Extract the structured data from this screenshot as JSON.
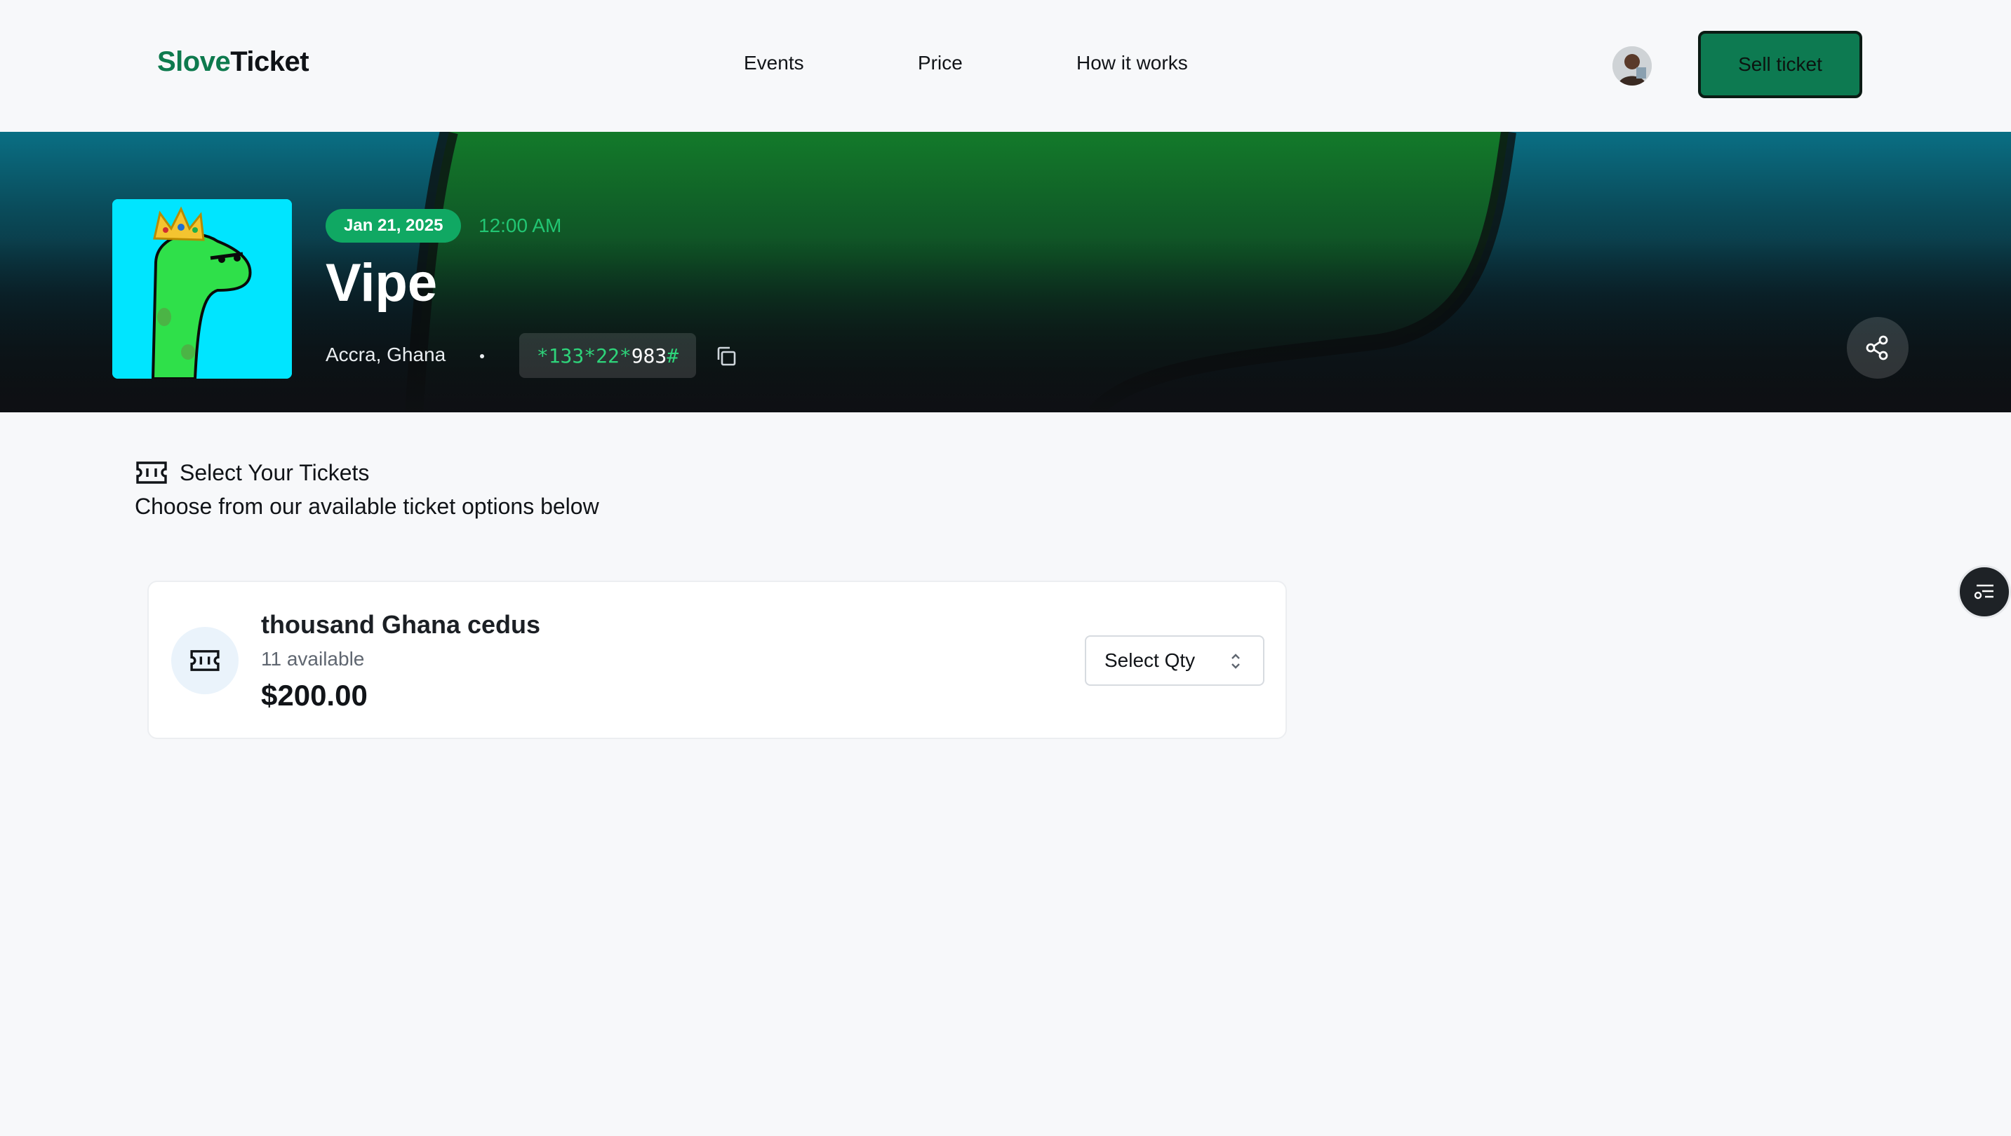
{
  "brand": {
    "part1": "Slove",
    "part2": "Ticket",
    "accent": "#0e7a4e"
  },
  "nav": {
    "items": [
      "Events",
      "Price",
      "How it works"
    ]
  },
  "header": {
    "sell_label": "Sell ticket",
    "sell_color": "#0d7a51"
  },
  "event": {
    "date": "Jan 21, 2025",
    "time": "12:00 AM",
    "title": "Vipe",
    "location": "Accra, Ghana",
    "ussd_prefix": "*133*22*",
    "ussd_number": "983",
    "ussd_suffix": "#"
  },
  "section": {
    "title": "Select Your Tickets",
    "subtitle": "Choose from our available ticket options below"
  },
  "tickets": [
    {
      "name": "thousand Ghana cedus",
      "available": "11 available",
      "price": "$200.00",
      "qty_placeholder": "Select Qty"
    }
  ],
  "icons": [
    "ticket-icon",
    "copy-icon",
    "share-icon",
    "chevron-updown-icon",
    "filter-icon",
    "avatar"
  ]
}
